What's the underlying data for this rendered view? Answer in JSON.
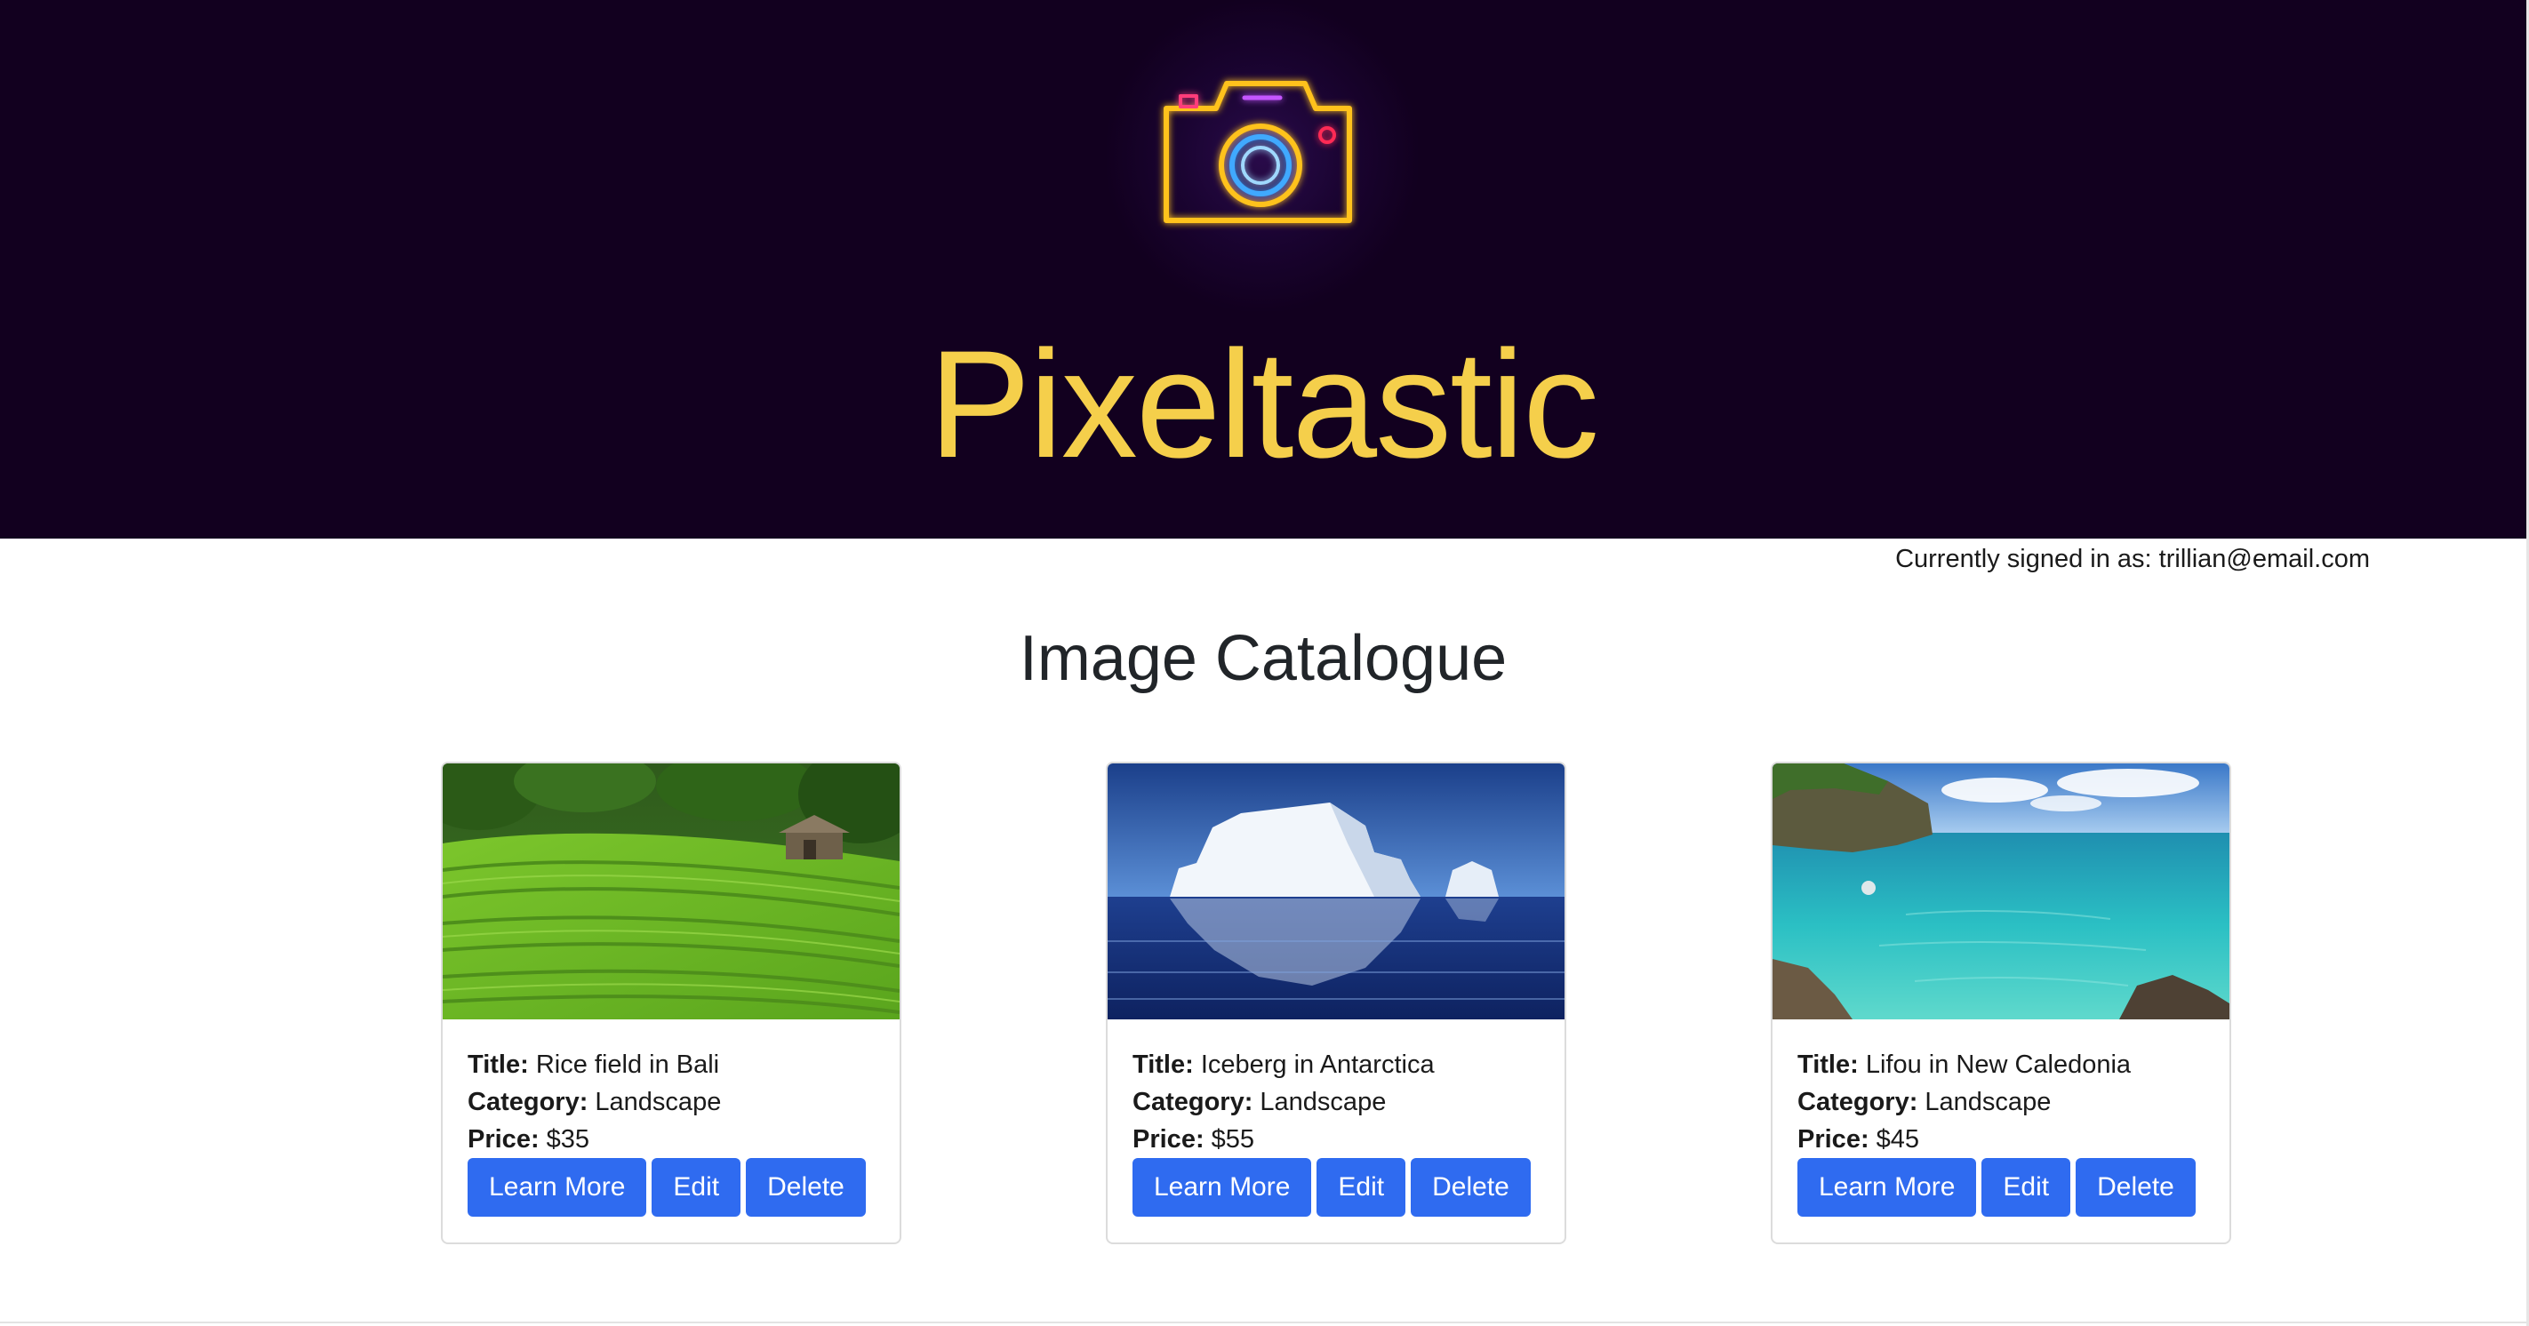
{
  "header": {
    "brand": "Pixeltastic",
    "logo_icon": "camera-neon-icon",
    "background_color": "#12001f",
    "brand_color": "#f5cf4b"
  },
  "session": {
    "signed_in_text": "Currently signed in as: trillian@email.com"
  },
  "main": {
    "title": "Image Catalogue"
  },
  "labels": {
    "title": "Title:",
    "category": "Category:",
    "price": "Price:"
  },
  "cards": [
    {
      "image": "rice-field-photo",
      "title": "Rice field in Bali",
      "category": "Landscape",
      "price": "$35",
      "learn_more": "Learn More",
      "edit": "Edit",
      "delete": "Delete"
    },
    {
      "image": "iceberg-photo",
      "title": "Iceberg in Antarctica",
      "category": "Landscape",
      "price": "$55",
      "learn_more": "Learn More",
      "edit": "Edit",
      "delete": "Delete"
    },
    {
      "image": "lagoon-photo",
      "title": "Lifou in New Caledonia",
      "category": "Landscape",
      "price": "$45",
      "learn_more": "Learn More",
      "edit": "Edit",
      "delete": "Delete"
    }
  ],
  "colors": {
    "button": "#2f6bf0",
    "card_border": "#dcdcdc"
  }
}
